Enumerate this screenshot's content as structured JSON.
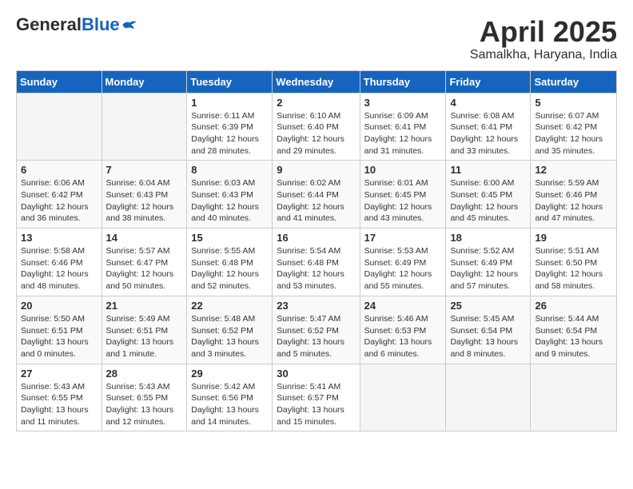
{
  "logo": {
    "general": "General",
    "blue": "Blue"
  },
  "title": "April 2025",
  "subtitle": "Samalkha, Haryana, India",
  "days_of_week": [
    "Sunday",
    "Monday",
    "Tuesday",
    "Wednesday",
    "Thursday",
    "Friday",
    "Saturday"
  ],
  "weeks": [
    [
      {
        "day": "",
        "info": ""
      },
      {
        "day": "",
        "info": ""
      },
      {
        "day": "1",
        "info": "Sunrise: 6:11 AM\nSunset: 6:39 PM\nDaylight: 12 hours and 28 minutes."
      },
      {
        "day": "2",
        "info": "Sunrise: 6:10 AM\nSunset: 6:40 PM\nDaylight: 12 hours and 29 minutes."
      },
      {
        "day": "3",
        "info": "Sunrise: 6:09 AM\nSunset: 6:41 PM\nDaylight: 12 hours and 31 minutes."
      },
      {
        "day": "4",
        "info": "Sunrise: 6:08 AM\nSunset: 6:41 PM\nDaylight: 12 hours and 33 minutes."
      },
      {
        "day": "5",
        "info": "Sunrise: 6:07 AM\nSunset: 6:42 PM\nDaylight: 12 hours and 35 minutes."
      }
    ],
    [
      {
        "day": "6",
        "info": "Sunrise: 6:06 AM\nSunset: 6:42 PM\nDaylight: 12 hours and 36 minutes."
      },
      {
        "day": "7",
        "info": "Sunrise: 6:04 AM\nSunset: 6:43 PM\nDaylight: 12 hours and 38 minutes."
      },
      {
        "day": "8",
        "info": "Sunrise: 6:03 AM\nSunset: 6:43 PM\nDaylight: 12 hours and 40 minutes."
      },
      {
        "day": "9",
        "info": "Sunrise: 6:02 AM\nSunset: 6:44 PM\nDaylight: 12 hours and 41 minutes."
      },
      {
        "day": "10",
        "info": "Sunrise: 6:01 AM\nSunset: 6:45 PM\nDaylight: 12 hours and 43 minutes."
      },
      {
        "day": "11",
        "info": "Sunrise: 6:00 AM\nSunset: 6:45 PM\nDaylight: 12 hours and 45 minutes."
      },
      {
        "day": "12",
        "info": "Sunrise: 5:59 AM\nSunset: 6:46 PM\nDaylight: 12 hours and 47 minutes."
      }
    ],
    [
      {
        "day": "13",
        "info": "Sunrise: 5:58 AM\nSunset: 6:46 PM\nDaylight: 12 hours and 48 minutes."
      },
      {
        "day": "14",
        "info": "Sunrise: 5:57 AM\nSunset: 6:47 PM\nDaylight: 12 hours and 50 minutes."
      },
      {
        "day": "15",
        "info": "Sunrise: 5:55 AM\nSunset: 6:48 PM\nDaylight: 12 hours and 52 minutes."
      },
      {
        "day": "16",
        "info": "Sunrise: 5:54 AM\nSunset: 6:48 PM\nDaylight: 12 hours and 53 minutes."
      },
      {
        "day": "17",
        "info": "Sunrise: 5:53 AM\nSunset: 6:49 PM\nDaylight: 12 hours and 55 minutes."
      },
      {
        "day": "18",
        "info": "Sunrise: 5:52 AM\nSunset: 6:49 PM\nDaylight: 12 hours and 57 minutes."
      },
      {
        "day": "19",
        "info": "Sunrise: 5:51 AM\nSunset: 6:50 PM\nDaylight: 12 hours and 58 minutes."
      }
    ],
    [
      {
        "day": "20",
        "info": "Sunrise: 5:50 AM\nSunset: 6:51 PM\nDaylight: 13 hours and 0 minutes."
      },
      {
        "day": "21",
        "info": "Sunrise: 5:49 AM\nSunset: 6:51 PM\nDaylight: 13 hours and 1 minute."
      },
      {
        "day": "22",
        "info": "Sunrise: 5:48 AM\nSunset: 6:52 PM\nDaylight: 13 hours and 3 minutes."
      },
      {
        "day": "23",
        "info": "Sunrise: 5:47 AM\nSunset: 6:52 PM\nDaylight: 13 hours and 5 minutes."
      },
      {
        "day": "24",
        "info": "Sunrise: 5:46 AM\nSunset: 6:53 PM\nDaylight: 13 hours and 6 minutes."
      },
      {
        "day": "25",
        "info": "Sunrise: 5:45 AM\nSunset: 6:54 PM\nDaylight: 13 hours and 8 minutes."
      },
      {
        "day": "26",
        "info": "Sunrise: 5:44 AM\nSunset: 6:54 PM\nDaylight: 13 hours and 9 minutes."
      }
    ],
    [
      {
        "day": "27",
        "info": "Sunrise: 5:43 AM\nSunset: 6:55 PM\nDaylight: 13 hours and 11 minutes."
      },
      {
        "day": "28",
        "info": "Sunrise: 5:43 AM\nSunset: 6:55 PM\nDaylight: 13 hours and 12 minutes."
      },
      {
        "day": "29",
        "info": "Sunrise: 5:42 AM\nSunset: 6:56 PM\nDaylight: 13 hours and 14 minutes."
      },
      {
        "day": "30",
        "info": "Sunrise: 5:41 AM\nSunset: 6:57 PM\nDaylight: 13 hours and 15 minutes."
      },
      {
        "day": "",
        "info": ""
      },
      {
        "day": "",
        "info": ""
      },
      {
        "day": "",
        "info": ""
      }
    ]
  ]
}
